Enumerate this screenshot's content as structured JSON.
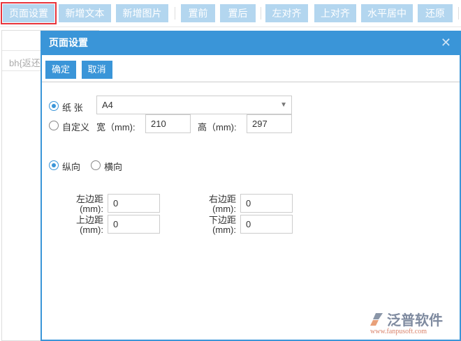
{
  "toolbar": {
    "buttons": [
      "页面设置",
      "新增文本",
      "新增图片",
      "置前",
      "置后",
      "左对齐",
      "上对齐",
      "水平居中",
      "还原"
    ]
  },
  "background": {
    "row_text": "bh{返还"
  },
  "dialog": {
    "title": "页面设置",
    "close_icon": "close-icon",
    "confirm": "确定",
    "cancel": "取消",
    "paper_label": "纸 张",
    "paper_value": "A4",
    "custom_label": "自定义",
    "width_label": "宽（mm):",
    "width_value": "210",
    "height_label": "高（mm):",
    "height_value": "297",
    "portrait": "纵向",
    "landscape": "横向",
    "paper_selected": "纸张",
    "orientation_selected": "纵向",
    "margins": {
      "left_label": "左边距",
      "right_label": "右边距",
      "top_label": "上边距",
      "bottom_label": "下边距",
      "unit": "(mm):",
      "left": "0",
      "right": "0",
      "top": "0",
      "bottom": "0"
    }
  },
  "logo": {
    "name": "泛普软件",
    "url": "www.fanpusoft.com"
  },
  "colors": {
    "accent": "#3a95d8",
    "toolbar_button": "#b3d6ef",
    "selected_outline": "#e8333a"
  }
}
